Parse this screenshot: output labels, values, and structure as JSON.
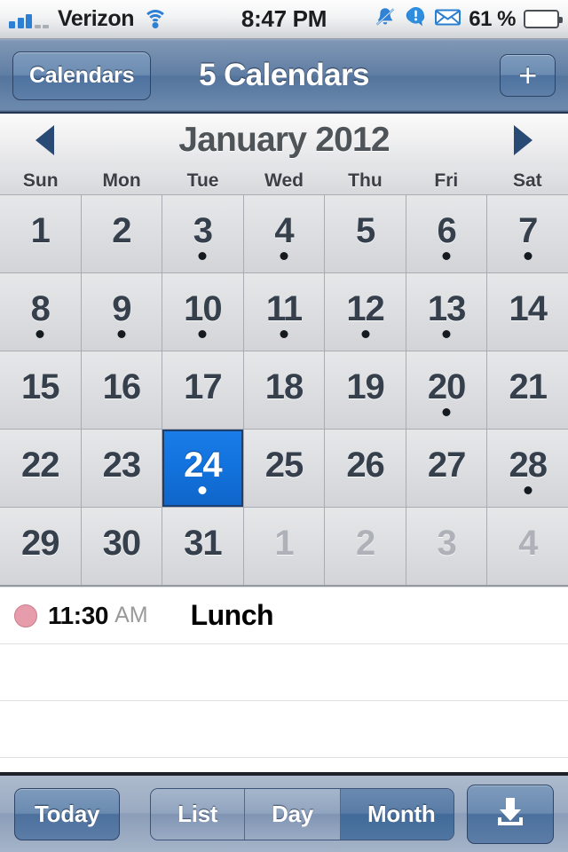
{
  "status_bar": {
    "carrier": "Verizon",
    "signal_bars_filled": 3,
    "signal_bars_total": 5,
    "wifi_icon": "wifi-icon",
    "time": "8:47 PM",
    "icons": [
      "bell-muted-icon",
      "alert-bubble-icon",
      "envelope-icon"
    ],
    "battery_percent": "61 %",
    "battery_level": 61,
    "battery_color": "#63c81e"
  },
  "nav_bar": {
    "back_label": "Calendars",
    "title": "5 Calendars",
    "add_label": "+"
  },
  "month_header": {
    "prev_icon": "triangle-left-icon",
    "label": "January 2012",
    "next_icon": "triangle-right-icon"
  },
  "weekdays": [
    "Sun",
    "Mon",
    "Tue",
    "Wed",
    "Thu",
    "Fri",
    "Sat"
  ],
  "calendar": {
    "month": "January",
    "year": "2012",
    "selected_day": "24",
    "selected_color": "#1272dd",
    "event_dot_color": "#151a20",
    "weeks": [
      [
        {
          "label": "1",
          "other": false,
          "dot": false
        },
        {
          "label": "2",
          "other": false,
          "dot": false
        },
        {
          "label": "3",
          "other": false,
          "dot": true
        },
        {
          "label": "4",
          "other": false,
          "dot": true
        },
        {
          "label": "5",
          "other": false,
          "dot": false
        },
        {
          "label": "6",
          "other": false,
          "dot": true
        },
        {
          "label": "7",
          "other": false,
          "dot": true
        }
      ],
      [
        {
          "label": "8",
          "other": false,
          "dot": true
        },
        {
          "label": "9",
          "other": false,
          "dot": true
        },
        {
          "label": "10",
          "other": false,
          "dot": true
        },
        {
          "label": "11",
          "other": false,
          "dot": true
        },
        {
          "label": "12",
          "other": false,
          "dot": true
        },
        {
          "label": "13",
          "other": false,
          "dot": true
        },
        {
          "label": "14",
          "other": false,
          "dot": false
        }
      ],
      [
        {
          "label": "15",
          "other": false,
          "dot": false
        },
        {
          "label": "16",
          "other": false,
          "dot": false
        },
        {
          "label": "17",
          "other": false,
          "dot": false
        },
        {
          "label": "18",
          "other": false,
          "dot": false
        },
        {
          "label": "19",
          "other": false,
          "dot": false
        },
        {
          "label": "20",
          "other": false,
          "dot": true
        },
        {
          "label": "21",
          "other": false,
          "dot": false
        }
      ],
      [
        {
          "label": "22",
          "other": false,
          "dot": false
        },
        {
          "label": "23",
          "other": false,
          "dot": false
        },
        {
          "label": "24",
          "other": false,
          "dot": true,
          "selected": true
        },
        {
          "label": "25",
          "other": false,
          "dot": false
        },
        {
          "label": "26",
          "other": false,
          "dot": false
        },
        {
          "label": "27",
          "other": false,
          "dot": false
        },
        {
          "label": "28",
          "other": false,
          "dot": true
        }
      ],
      [
        {
          "label": "29",
          "other": false,
          "dot": false
        },
        {
          "label": "30",
          "other": false,
          "dot": false
        },
        {
          "label": "31",
          "other": false,
          "dot": false
        },
        {
          "label": "1",
          "other": true,
          "dot": false
        },
        {
          "label": "2",
          "other": true,
          "dot": false
        },
        {
          "label": "3",
          "other": true,
          "dot": false
        },
        {
          "label": "4",
          "other": true,
          "dot": false
        }
      ]
    ]
  },
  "events": [
    {
      "dot_color": "#e69cab",
      "time": "11:30",
      "ampm": "AM",
      "title": "Lunch"
    }
  ],
  "toolbar": {
    "today_label": "Today",
    "segments": [
      {
        "label": "List",
        "active": false
      },
      {
        "label": "Day",
        "active": false
      },
      {
        "label": "Month",
        "active": true
      }
    ],
    "action_icon": "download-inbox-icon"
  }
}
